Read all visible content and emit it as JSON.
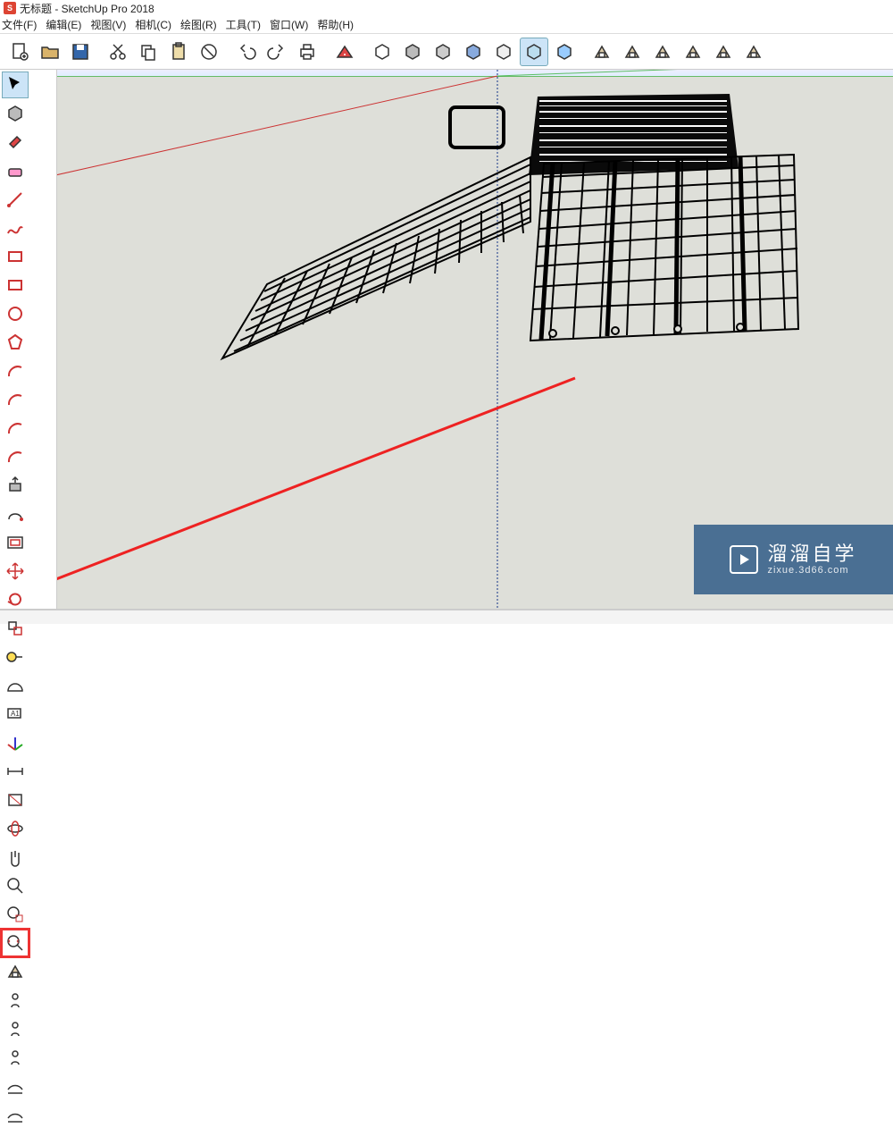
{
  "title": "无标题 - SketchUp Pro 2018",
  "menu": {
    "file": "文件(F)",
    "edit": "编辑(E)",
    "view": "视图(V)",
    "camera": "相机(C)",
    "draw": "绘图(R)",
    "tools": "工具(T)",
    "window": "窗口(W)",
    "help": "帮助(H)"
  },
  "main_toolbar_icons": [
    "new-file",
    "open-file",
    "save-file",
    "cut",
    "copy",
    "paste",
    "delete",
    "undo",
    "redo",
    "print",
    "model-info",
    "style-wireframe",
    "style-hidden",
    "style-shaded",
    "style-textured",
    "style-mono",
    "style-xray",
    "style-backedge",
    "iso-view",
    "top-view",
    "front-view",
    "right-view",
    "back-view",
    "left-view"
  ],
  "active_main_tool_index": 16,
  "left_toolbar_icons": [
    "select",
    "component",
    "paint",
    "eraser",
    "line",
    "freehand",
    "rect",
    "rotated-rect",
    "circle",
    "polygon",
    "arc",
    "2pt-arc",
    "3pt-arc",
    "pie",
    "push-pull",
    "follow-me",
    "offset",
    "move",
    "rotate",
    "scale",
    "tape",
    "protractor",
    "text",
    "axes",
    "dimension",
    "section",
    "orbit",
    "pan",
    "zoom",
    "zoom-window",
    "zoom-extents",
    "prev-view",
    "position-camera",
    "look-around",
    "walk",
    "sandbox-1",
    "sandbox-2"
  ],
  "selected_left_tool_index": 0,
  "highlighted_left_tool_index": 30,
  "watermark": {
    "brand": "溜溜自学",
    "url": "zixue.3d66.com"
  },
  "statusbar_text": ""
}
